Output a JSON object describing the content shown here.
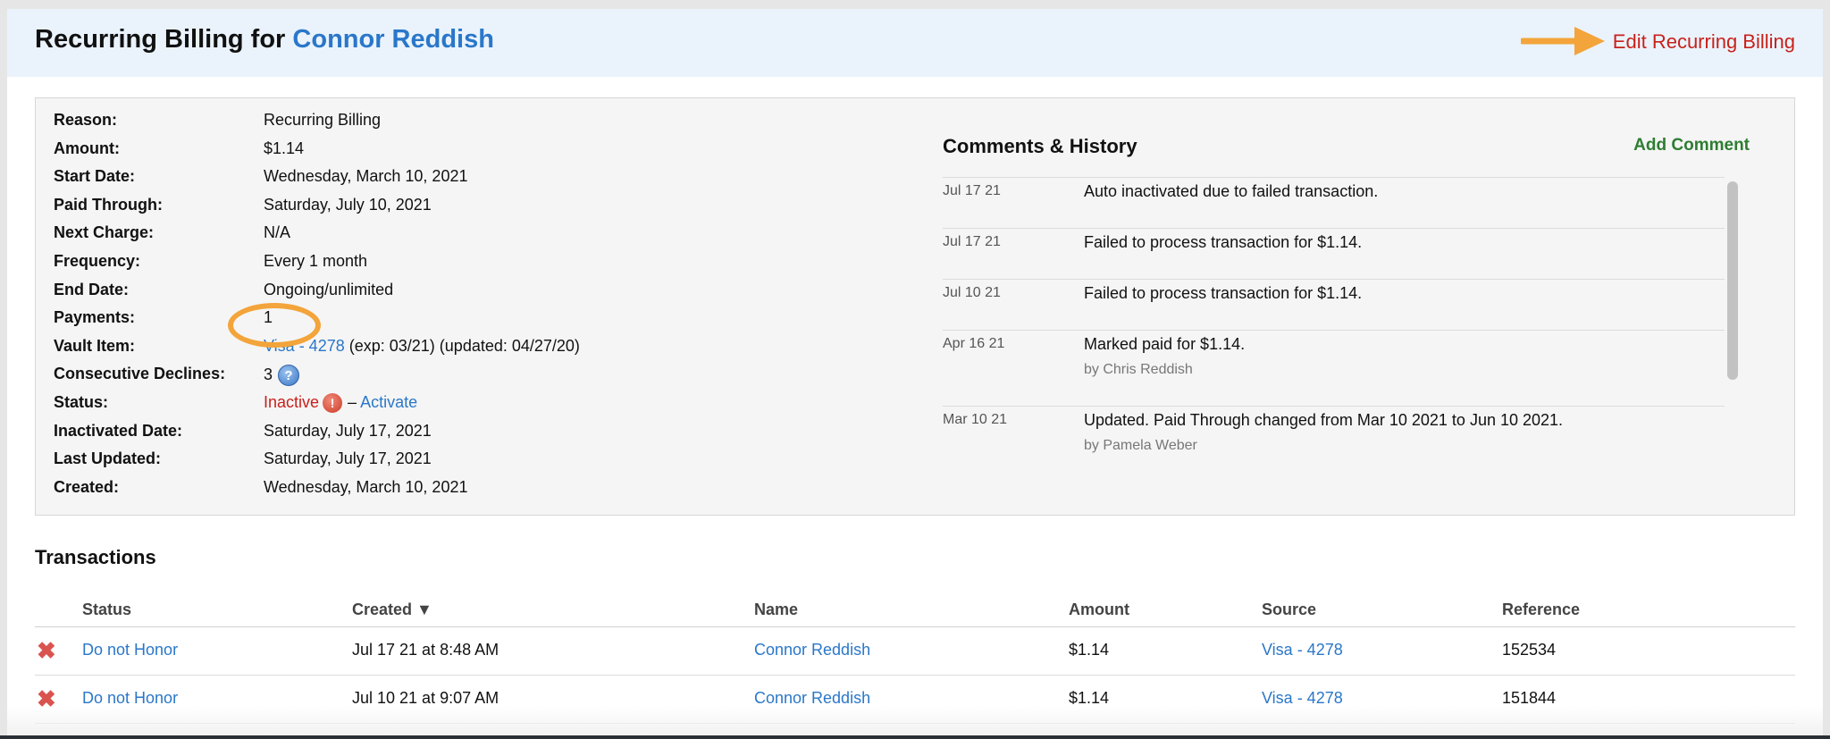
{
  "header": {
    "title_prefix": "Recurring Billing for",
    "customer_name": "Connor Reddish",
    "edit_link": "Edit Recurring Billing"
  },
  "details": [
    {
      "label": "Reason:",
      "value": "Recurring Billing"
    },
    {
      "label": "Amount:",
      "value": "$1.14"
    },
    {
      "label": "Start Date:",
      "value": "Wednesday, March 10, 2021"
    },
    {
      "label": "Paid Through:",
      "value": "Saturday, July 10, 2021"
    },
    {
      "label": "Next Charge:",
      "value": "N/A"
    },
    {
      "label": "Frequency:",
      "value": "Every 1 month"
    },
    {
      "label": "End Date:",
      "value": "Ongoing/unlimited"
    },
    {
      "label": "Payments:",
      "value": "1"
    },
    {
      "label": "Vault Item:",
      "link": "Visa - 4278",
      "value": "(exp: 03/21) (updated: 04/27/20)"
    },
    {
      "label": "Consecutive Declines:",
      "value": "3"
    },
    {
      "label": "Status:",
      "value": "Inactive",
      "separator": "–",
      "link": "Activate"
    },
    {
      "label": "Inactivated Date:",
      "value": "Saturday, July 17, 2021"
    },
    {
      "label": "Last Updated:",
      "value": "Saturday, July 17, 2021"
    },
    {
      "label": "Created:",
      "value": "Wednesday, March 10, 2021"
    }
  ],
  "comments": {
    "title": "Comments & History",
    "add_label": "Add Comment",
    "items": [
      {
        "date": "Jul 17 21",
        "text": "Auto inactivated due to failed transaction.",
        "by": ""
      },
      {
        "date": "Jul 17 21",
        "text": "Failed to process transaction for $1.14.",
        "by": ""
      },
      {
        "date": "Jul 10 21",
        "text": "Failed to process transaction for $1.14.",
        "by": ""
      },
      {
        "date": "Apr 16 21",
        "text": "Marked paid for $1.14.",
        "by": "by Chris Reddish"
      },
      {
        "date": "Mar 10 21",
        "text": "Updated. Paid Through changed from Mar 10 2021 to Jun 10 2021.",
        "by": "by Pamela Weber"
      }
    ]
  },
  "transactions": {
    "title": "Transactions",
    "columns": [
      "Status",
      "Created ▼",
      "Name",
      "Amount",
      "Source",
      "Reference"
    ],
    "rows": [
      {
        "status": "Do not Honor",
        "created": "Jul 17 21 at 8:48 AM",
        "name": "Connor Reddish",
        "amount": "$1.14",
        "source": "Visa - 4278",
        "reference": "152534"
      },
      {
        "status": "Do not Honor",
        "created": "Jul 10 21 at 9:07 AM",
        "name": "Connor Reddish",
        "amount": "$1.14",
        "source": "Visa - 4278",
        "reference": "151844"
      }
    ]
  },
  "colors": {
    "link": "#2a77c9",
    "error": "#c8211b",
    "annotation": "#f3a43a",
    "add_comment": "#2e7d32"
  }
}
